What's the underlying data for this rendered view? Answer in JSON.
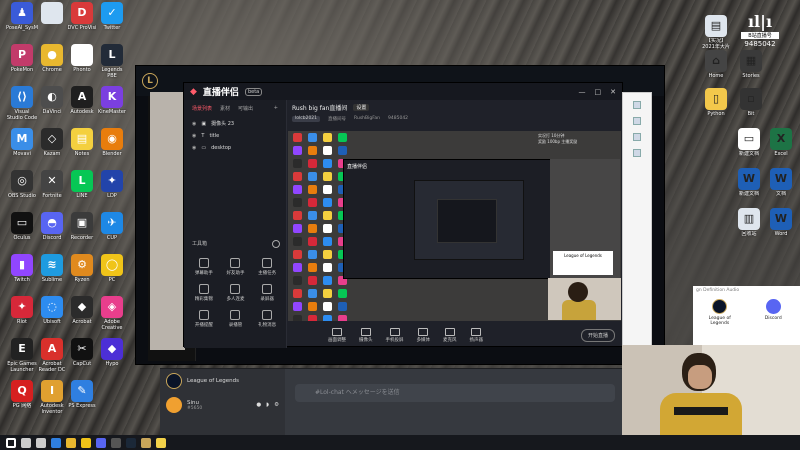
{
  "desktop": {
    "left_icons": [
      {
        "label": "PoseAI_SysMonAnyOri",
        "color": "#3a5bd8",
        "glyph": "♟"
      },
      {
        "label": "",
        "color": "#dfe6ee",
        "glyph": ""
      },
      {
        "label": "DVC ProVisi",
        "color": "#d93a3a",
        "glyph": "D"
      },
      {
        "label": "Twitter",
        "color": "#1d9bf0",
        "glyph": "✓"
      },
      {
        "label": "PokeMon",
        "color": "#c23b6a",
        "glyph": "P"
      },
      {
        "label": "Chrome",
        "color": "#e9b82f",
        "glyph": "●"
      },
      {
        "label": "Phonto",
        "color": "#ffffff",
        "glyph": "▲"
      },
      {
        "label": "Legends PBE",
        "color": "#222b38",
        "glyph": "L"
      },
      {
        "label": "Visual Studio Code",
        "color": "#2a7ad6",
        "glyph": "⟨⟩"
      },
      {
        "label": "DaVinci",
        "color": "#4d4d4d",
        "glyph": "◐"
      },
      {
        "label": "Autodesk",
        "color": "#1f1f1f",
        "glyph": "A"
      },
      {
        "label": "KineMaster",
        "color": "#7b3fe0",
        "glyph": "K"
      },
      {
        "label": "Movavi",
        "color": "#3a8ee8",
        "glyph": "M"
      },
      {
        "label": "Kazam",
        "color": "#2b2b2b",
        "glyph": "◇"
      },
      {
        "label": "Notes",
        "color": "#f4d03f",
        "glyph": "▤"
      },
      {
        "label": "Blender",
        "color": "#e87d0d",
        "glyph": "◉"
      },
      {
        "label": "OBS Studio",
        "color": "#333333",
        "glyph": "◎"
      },
      {
        "label": "Fortnite",
        "color": "#444444",
        "glyph": "✕"
      },
      {
        "label": "LINE",
        "color": "#06c755",
        "glyph": "L"
      },
      {
        "label": "LDP",
        "color": "#2244aa",
        "glyph": "✦"
      },
      {
        "label": "Oculus",
        "color": "#111111",
        "glyph": "▭"
      },
      {
        "label": "Discord",
        "color": "#5865f2",
        "glyph": "◓"
      },
      {
        "label": "Recorder",
        "color": "#3b3b3b",
        "glyph": "▣"
      },
      {
        "label": "CUP",
        "color": "#1e88e5",
        "glyph": "✈"
      },
      {
        "label": "Twitch",
        "color": "#9146ff",
        "glyph": "▮"
      },
      {
        "label": "Sublime",
        "color": "#1e9be0",
        "glyph": "≋"
      },
      {
        "label": "Ryzen",
        "color": "#e08a1e",
        "glyph": "⚙"
      },
      {
        "label": "PC",
        "color": "#f0c419",
        "glyph": "◯"
      },
      {
        "label": "Riot",
        "color": "#d62839",
        "glyph": "✦"
      },
      {
        "label": "Ubisoft",
        "color": "#2d8cf0",
        "glyph": "◌"
      },
      {
        "label": "Acrobat",
        "color": "#2b2b2b",
        "glyph": "◆"
      },
      {
        "label": "Adobe Creative",
        "color": "#e83e8c",
        "glyph": "◈"
      },
      {
        "label": "Epic Games Launcher",
        "color": "#222222",
        "glyph": "E"
      },
      {
        "label": "Acrobat Reader DC",
        "color": "#d9302b",
        "glyph": "A"
      },
      {
        "label": "CapCut",
        "color": "#111111",
        "glyph": "✂"
      },
      {
        "label": "Hypo",
        "color": "#4c2fd6",
        "glyph": "◆"
      },
      {
        "label": "PG 网络",
        "color": "#d62020",
        "glyph": "Q"
      },
      {
        "label": "Autodesk Inventor",
        "color": "#e0a030",
        "glyph": "I"
      },
      {
        "label": "PS Express",
        "color": "#2f7fe0",
        "glyph": "✎"
      }
    ],
    "right_icons": [
      {
        "label": "【实况】2021年大片",
        "color": "#dfe6ee",
        "glyph": "▤"
      },
      {
        "label": "Home",
        "color": "#444",
        "glyph": "⌂"
      },
      {
        "label": "Stories",
        "color": "#3a3a3a",
        "glyph": "▦"
      },
      {
        "label": "Python",
        "color": "#f3c84b",
        "glyph": "▯"
      },
      {
        "label": "Bit",
        "color": "#333",
        "glyph": "▫"
      },
      {
        "label": "新建文档",
        "color": "#ffffff",
        "glyph": "▭"
      },
      {
        "label": "Excel",
        "color": "#1d7345",
        "glyph": "X"
      },
      {
        "label": "新建文档",
        "color": "#1e5fb6",
        "glyph": "W"
      },
      {
        "label": "文档",
        "color": "#1e5fb6",
        "glyph": "W"
      },
      {
        "label": "回收站",
        "color": "#dfe6ee",
        "glyph": "▥"
      },
      {
        "label": "Word",
        "color": "#1e5fb6",
        "glyph": "W"
      }
    ],
    "bilibili": {
      "logo": "ıl|ı",
      "tag": "B站直播号",
      "id": "9485042"
    }
  },
  "lol_client": {
    "logo": "L",
    "yy_label": "YY"
  },
  "obs": {
    "brand": "直播伴侣",
    "version": "beta",
    "window_controls": [
      "—",
      "□",
      "✕"
    ],
    "scene_tabs": [
      {
        "label": "场景列表",
        "active": true
      },
      {
        "label": "素材",
        "active": false
      },
      {
        "label": "可输出",
        "active": false
      }
    ],
    "sources": [
      {
        "label": "摄像头 23"
      },
      {
        "label": "title"
      },
      {
        "label": "desktop"
      }
    ],
    "tools_title": "工具箱",
    "tools": [
      "弹幕助手",
      "好友助手",
      "主播任务",
      "精彩集锦",
      "多人连麦",
      "录屏器",
      "开播提醒",
      "录播管",
      "礼物消息"
    ],
    "head_title": "Rush big fan直播间",
    "head_tag": "设置",
    "sub": [
      "lolcb2021",
      "直播间号",
      "RushBigFan",
      "9485042"
    ],
    "preview_banner": [
      "实况打 10分钟",
      "奖励 100bp 主播奖励"
    ],
    "preview_brand": "直播伴侣",
    "preview_lol": "League of Legends",
    "bottom_actions": [
      "画面调整",
      "摄像头",
      "手机投屏",
      "多媒体",
      "麦克风",
      "扬声器"
    ],
    "start_label": "开始直播"
  },
  "discord": {
    "rows": [
      {
        "name": "League of Legends",
        "sub": ""
      },
      {
        "name": "Sinu",
        "sub": "#5650"
      }
    ],
    "input_placeholder": "#Lol-chat へメッセージを送信"
  },
  "lol_friend": {
    "header": "gn Definition Audio",
    "items": [
      {
        "label": "League of Legends",
        "color": "#0a1428"
      },
      {
        "label": "Discord",
        "color": "#5865f2"
      }
    ]
  },
  "taskbar": {
    "icons": [
      "start",
      "search",
      "task",
      "edge",
      "chrome",
      "explorer",
      "discord",
      "obs",
      "steam",
      "lol",
      "yy"
    ]
  }
}
